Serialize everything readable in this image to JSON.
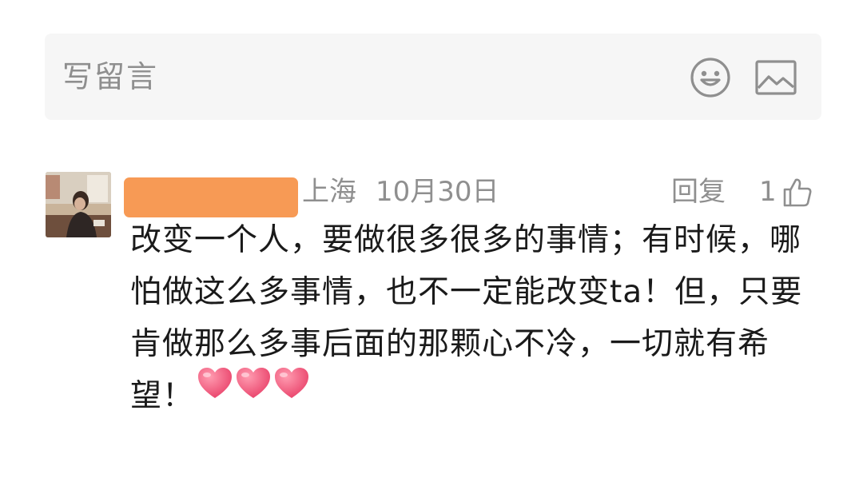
{
  "comment_input": {
    "placeholder": "写留言",
    "emoji_icon": "emoji-smile-icon",
    "image_icon": "image-picture-icon"
  },
  "comment": {
    "nickname_redacted": true,
    "location": "上海",
    "date": "10月30日",
    "reply_label": "回复",
    "like_count": "1",
    "text_lines": [
      "改变一个人，要做很多很多的事情；有时候，哪",
      "怕做这么多事情，也不一定能改变ta！但，只要",
      "肯做那么多事后面的那颗心不冷，一切就有希",
      "望！"
    ],
    "hearts_count": 3
  },
  "colors": {
    "secondary_text": "#8f8f8f",
    "body_text": "#1a1a1a",
    "input_bg": "#f6f6f6",
    "redaction": "#f79a55",
    "heart": "#f25b7a"
  }
}
